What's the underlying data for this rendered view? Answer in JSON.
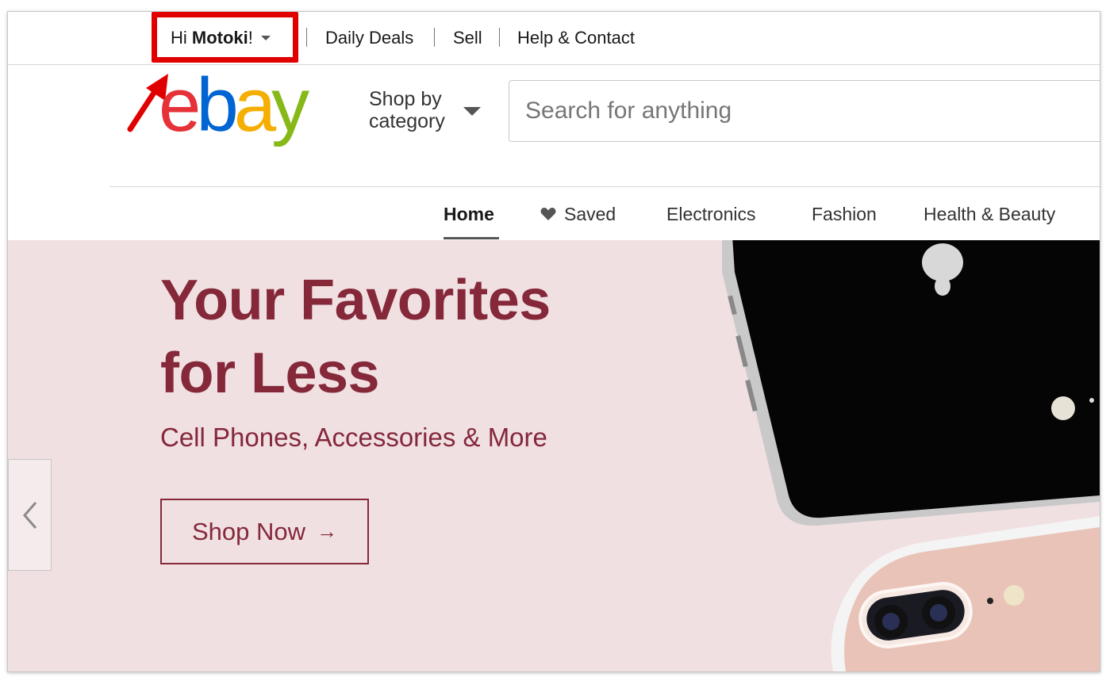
{
  "topbar": {
    "greeting_prefix": "Hi ",
    "user_name": "Motoki",
    "greeting_suffix": "!",
    "links": [
      "Daily Deals",
      "Sell",
      "Help & Contact"
    ]
  },
  "header": {
    "shop_by_line1": "Shop by",
    "shop_by_line2": "category",
    "search_placeholder": "Search for anything"
  },
  "nav": {
    "items": [
      "Home",
      "Saved",
      "Electronics",
      "Fashion",
      "Health & Beauty"
    ],
    "active": "Home"
  },
  "hero": {
    "title_line1": "Your Favorites",
    "title_line2": "for Less",
    "subtitle": "Cell Phones, Accessories & More",
    "cta": "Shop Now",
    "cta_arrow": "→"
  },
  "colors": {
    "highlight": "#e00000",
    "hero_bg": "#f1e0e2",
    "hero_text": "#84283a",
    "logo_e": "#e53238",
    "logo_b": "#0064d2",
    "logo_a": "#f5af02",
    "logo_y": "#86b817"
  },
  "icons": [
    "chevron-down-icon",
    "heart-icon",
    "arrow-right-icon",
    "chevron-left-icon",
    "pointer-arrow-icon"
  ]
}
